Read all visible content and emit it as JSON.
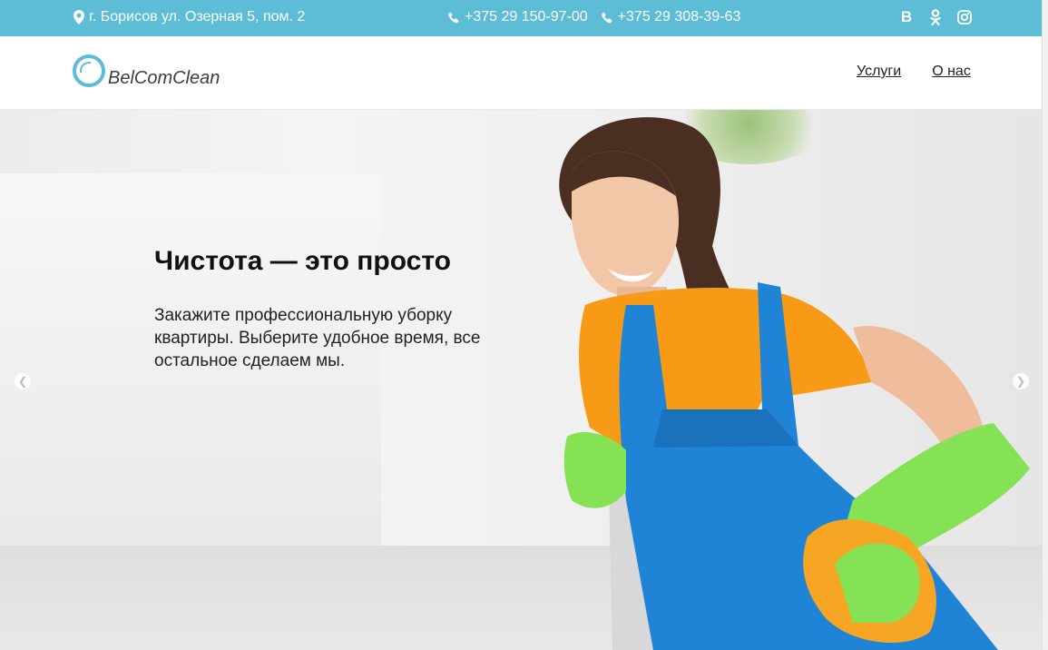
{
  "topbar": {
    "address": "г. Борисов ул. Озерная 5, пом. 2",
    "phones": [
      "+375 29 150-97-00",
      "+375 29 308-39-63"
    ],
    "social": {
      "vk": "В",
      "ok": "ok-icon",
      "instagram": "instagram-icon"
    },
    "accent_color": "#5dbcd6"
  },
  "header": {
    "logo_text": "BelComClean",
    "nav": {
      "services": "Услуги",
      "about": "О нас"
    }
  },
  "hero": {
    "title": "Чистота — это просто",
    "lead": "Закажите профессиональную уборку квартиры. Выберите удобное время, все остальное сделаем мы."
  }
}
